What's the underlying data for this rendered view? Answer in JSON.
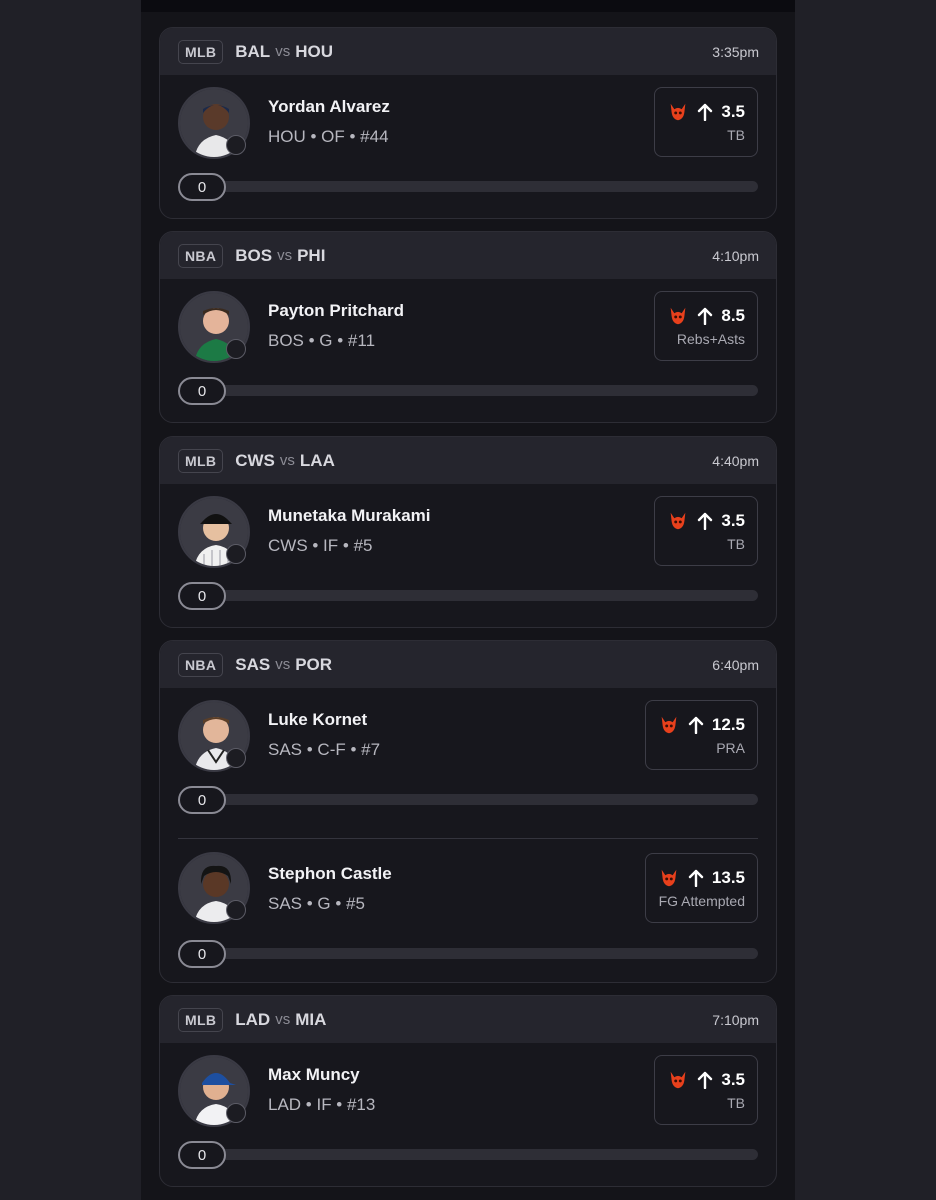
{
  "colors": {
    "background": "#202027",
    "panel": "#141419",
    "card": "#17171d",
    "card_header": "#25252d",
    "accent_devil": "#e8401c"
  },
  "games": [
    {
      "league": "MLB",
      "home": "BAL",
      "vs": "vs",
      "away": "HOU",
      "time": "3:35pm",
      "picks": [
        {
          "name": "Yordan Alvarez",
          "meta": "HOU • OF • #44",
          "line": "3.5",
          "stat": "TB",
          "progress": "0",
          "direction": "over"
        }
      ]
    },
    {
      "league": "NBA",
      "home": "BOS",
      "vs": "vs",
      "away": "PHI",
      "time": "4:10pm",
      "picks": [
        {
          "name": "Payton Pritchard",
          "meta": "BOS • G • #11",
          "line": "8.5",
          "stat": "Rebs+Asts",
          "progress": "0",
          "direction": "over"
        }
      ]
    },
    {
      "league": "MLB",
      "home": "CWS",
      "vs": "vs",
      "away": "LAA",
      "time": "4:40pm",
      "picks": [
        {
          "name": "Munetaka Murakami",
          "meta": "CWS • IF • #5",
          "line": "3.5",
          "stat": "TB",
          "progress": "0",
          "direction": "over"
        }
      ]
    },
    {
      "league": "NBA",
      "home": "SAS",
      "vs": "vs",
      "away": "POR",
      "time": "6:40pm",
      "picks": [
        {
          "name": "Luke Kornet",
          "meta": "SAS • C-F • #7",
          "line": "12.5",
          "stat": "PRA",
          "progress": "0",
          "direction": "over"
        },
        {
          "name": "Stephon Castle",
          "meta": "SAS • G • #5",
          "line": "13.5",
          "stat": "FG Attempted",
          "progress": "0",
          "direction": "over"
        }
      ]
    },
    {
      "league": "MLB",
      "home": "LAD",
      "vs": "vs",
      "away": "MIA",
      "time": "7:10pm",
      "picks": [
        {
          "name": "Max Muncy",
          "meta": "LAD • IF • #13",
          "line": "3.5",
          "stat": "TB",
          "progress": "0",
          "direction": "over"
        }
      ]
    }
  ],
  "icons": {
    "avatar": "player-headshot",
    "clock": "clock-icon",
    "devil": "devil-icon",
    "arrow": "arrow-up-icon"
  }
}
